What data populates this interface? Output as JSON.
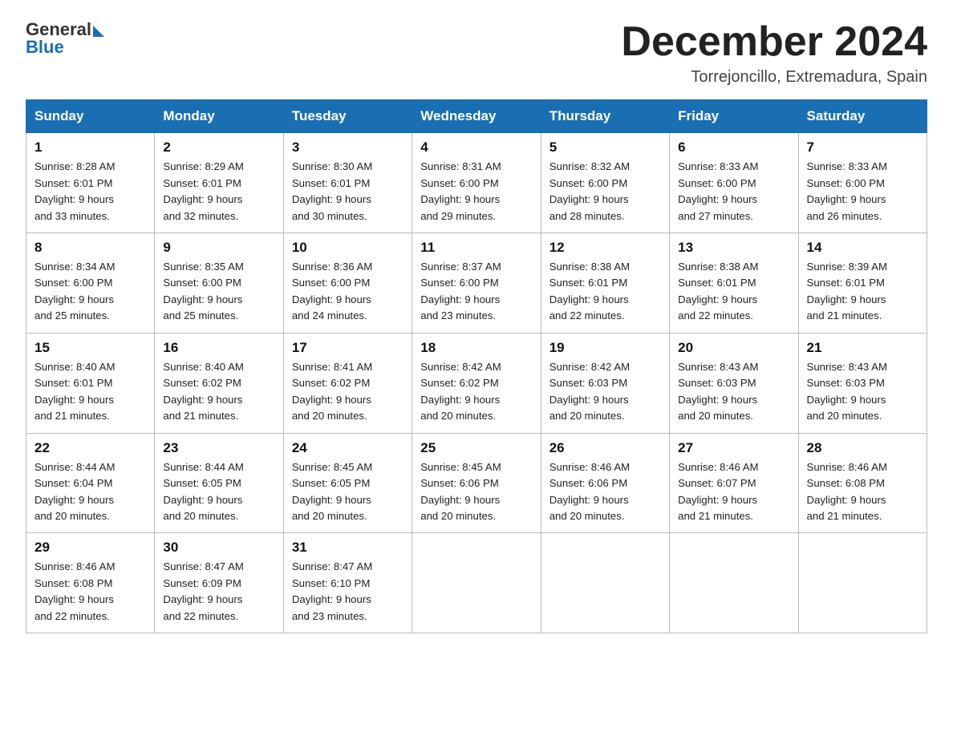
{
  "logo": {
    "text_general": "General",
    "text_blue": "Blue"
  },
  "header": {
    "month_title": "December 2024",
    "location": "Torrejoncillo, Extremadura, Spain"
  },
  "weekdays": [
    "Sunday",
    "Monday",
    "Tuesday",
    "Wednesday",
    "Thursday",
    "Friday",
    "Saturday"
  ],
  "weeks": [
    [
      {
        "day": "1",
        "sunrise": "8:28 AM",
        "sunset": "6:01 PM",
        "daylight": "9 hours and 33 minutes."
      },
      {
        "day": "2",
        "sunrise": "8:29 AM",
        "sunset": "6:01 PM",
        "daylight": "9 hours and 32 minutes."
      },
      {
        "day": "3",
        "sunrise": "8:30 AM",
        "sunset": "6:01 PM",
        "daylight": "9 hours and 30 minutes."
      },
      {
        "day": "4",
        "sunrise": "8:31 AM",
        "sunset": "6:00 PM",
        "daylight": "9 hours and 29 minutes."
      },
      {
        "day": "5",
        "sunrise": "8:32 AM",
        "sunset": "6:00 PM",
        "daylight": "9 hours and 28 minutes."
      },
      {
        "day": "6",
        "sunrise": "8:33 AM",
        "sunset": "6:00 PM",
        "daylight": "9 hours and 27 minutes."
      },
      {
        "day": "7",
        "sunrise": "8:33 AM",
        "sunset": "6:00 PM",
        "daylight": "9 hours and 26 minutes."
      }
    ],
    [
      {
        "day": "8",
        "sunrise": "8:34 AM",
        "sunset": "6:00 PM",
        "daylight": "9 hours and 25 minutes."
      },
      {
        "day": "9",
        "sunrise": "8:35 AM",
        "sunset": "6:00 PM",
        "daylight": "9 hours and 25 minutes."
      },
      {
        "day": "10",
        "sunrise": "8:36 AM",
        "sunset": "6:00 PM",
        "daylight": "9 hours and 24 minutes."
      },
      {
        "day": "11",
        "sunrise": "8:37 AM",
        "sunset": "6:00 PM",
        "daylight": "9 hours and 23 minutes."
      },
      {
        "day": "12",
        "sunrise": "8:38 AM",
        "sunset": "6:01 PM",
        "daylight": "9 hours and 22 minutes."
      },
      {
        "day": "13",
        "sunrise": "8:38 AM",
        "sunset": "6:01 PM",
        "daylight": "9 hours and 22 minutes."
      },
      {
        "day": "14",
        "sunrise": "8:39 AM",
        "sunset": "6:01 PM",
        "daylight": "9 hours and 21 minutes."
      }
    ],
    [
      {
        "day": "15",
        "sunrise": "8:40 AM",
        "sunset": "6:01 PM",
        "daylight": "9 hours and 21 minutes."
      },
      {
        "day": "16",
        "sunrise": "8:40 AM",
        "sunset": "6:02 PM",
        "daylight": "9 hours and 21 minutes."
      },
      {
        "day": "17",
        "sunrise": "8:41 AM",
        "sunset": "6:02 PM",
        "daylight": "9 hours and 20 minutes."
      },
      {
        "day": "18",
        "sunrise": "8:42 AM",
        "sunset": "6:02 PM",
        "daylight": "9 hours and 20 minutes."
      },
      {
        "day": "19",
        "sunrise": "8:42 AM",
        "sunset": "6:03 PM",
        "daylight": "9 hours and 20 minutes."
      },
      {
        "day": "20",
        "sunrise": "8:43 AM",
        "sunset": "6:03 PM",
        "daylight": "9 hours and 20 minutes."
      },
      {
        "day": "21",
        "sunrise": "8:43 AM",
        "sunset": "6:03 PM",
        "daylight": "9 hours and 20 minutes."
      }
    ],
    [
      {
        "day": "22",
        "sunrise": "8:44 AM",
        "sunset": "6:04 PM",
        "daylight": "9 hours and 20 minutes."
      },
      {
        "day": "23",
        "sunrise": "8:44 AM",
        "sunset": "6:05 PM",
        "daylight": "9 hours and 20 minutes."
      },
      {
        "day": "24",
        "sunrise": "8:45 AM",
        "sunset": "6:05 PM",
        "daylight": "9 hours and 20 minutes."
      },
      {
        "day": "25",
        "sunrise": "8:45 AM",
        "sunset": "6:06 PM",
        "daylight": "9 hours and 20 minutes."
      },
      {
        "day": "26",
        "sunrise": "8:46 AM",
        "sunset": "6:06 PM",
        "daylight": "9 hours and 20 minutes."
      },
      {
        "day": "27",
        "sunrise": "8:46 AM",
        "sunset": "6:07 PM",
        "daylight": "9 hours and 21 minutes."
      },
      {
        "day": "28",
        "sunrise": "8:46 AM",
        "sunset": "6:08 PM",
        "daylight": "9 hours and 21 minutes."
      }
    ],
    [
      {
        "day": "29",
        "sunrise": "8:46 AM",
        "sunset": "6:08 PM",
        "daylight": "9 hours and 22 minutes."
      },
      {
        "day": "30",
        "sunrise": "8:47 AM",
        "sunset": "6:09 PM",
        "daylight": "9 hours and 22 minutes."
      },
      {
        "day": "31",
        "sunrise": "8:47 AM",
        "sunset": "6:10 PM",
        "daylight": "9 hours and 23 minutes."
      },
      null,
      null,
      null,
      null
    ]
  ],
  "labels": {
    "sunrise": "Sunrise:",
    "sunset": "Sunset:",
    "daylight": "Daylight:"
  }
}
